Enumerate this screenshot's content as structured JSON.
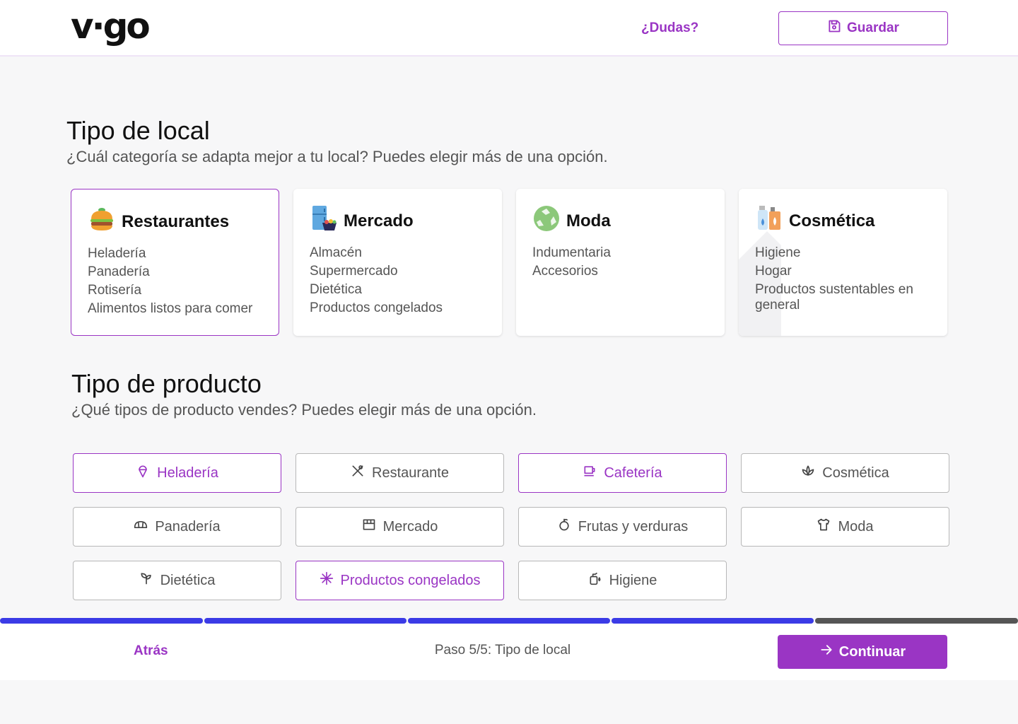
{
  "header": {
    "logo": "v·go",
    "help_link": "¿Dudas?",
    "save_label": "Guardar",
    "accent_color": "#9a35c4"
  },
  "local_section": {
    "title": "Tipo de local",
    "subtitle": "¿Cuál categoría se adapta mejor a tu local? Puedes elegir más de una opción.",
    "cards": [
      {
        "name": "Restaurantes",
        "icon": "burger-emoji",
        "selected": true,
        "items": [
          "Heladería",
          "Panadería",
          "Rotisería",
          "Alimentos listos para comer"
        ]
      },
      {
        "name": "Mercado",
        "icon": "fridge-emoji",
        "selected": false,
        "items": [
          "Almacén",
          "Supermercado",
          "Dietética",
          "Productos congelados"
        ]
      },
      {
        "name": "Moda",
        "icon": "recycle-emoji",
        "selected": false,
        "items": [
          "Indumentaria",
          "Accesorios"
        ]
      },
      {
        "name": "Cosmética",
        "icon": "cosmetics-emoji",
        "selected": false,
        "items": [
          "Higiene",
          "Hogar",
          "Productos sustentables en general"
        ]
      }
    ]
  },
  "product_section": {
    "title": "Tipo de producto",
    "subtitle": "¿Qué tipos de producto vendes? Puedes elegir más de una opción.",
    "options": [
      {
        "label": "Heladería",
        "icon": "ice-cream-icon",
        "selected": true
      },
      {
        "label": "Restaurante",
        "icon": "utensils-icon",
        "selected": false
      },
      {
        "label": "Cafetería",
        "icon": "coffee-cup-icon",
        "selected": true
      },
      {
        "label": "Cosmética",
        "icon": "lotus-icon",
        "selected": false
      },
      {
        "label": "Panadería",
        "icon": "croissant-icon",
        "selected": false
      },
      {
        "label": "Mercado",
        "icon": "store-icon",
        "selected": false
      },
      {
        "label": "Frutas y verduras",
        "icon": "apple-icon",
        "selected": false
      },
      {
        "label": "Moda",
        "icon": "shirt-icon",
        "selected": false
      },
      {
        "label": "Dietética",
        "icon": "sprout-icon",
        "selected": false
      },
      {
        "label": "Productos congelados",
        "icon": "snowflake-icon",
        "selected": true
      },
      {
        "label": "Higiene",
        "icon": "soap-icon",
        "selected": false
      }
    ]
  },
  "progress": {
    "total_steps": 5,
    "completed_steps": 4,
    "active_color": "#3b3be6",
    "inactive_color": "#555555"
  },
  "footer": {
    "back_label": "Atrás",
    "step_text": "Paso 5/5: Tipo de local",
    "continue_label": "Continuar"
  }
}
